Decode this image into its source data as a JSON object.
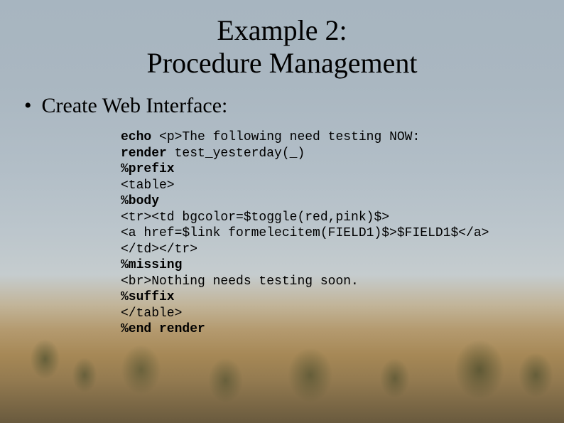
{
  "title_line1": "Example 2:",
  "title_line2": "Procedure Management",
  "bullet": "•",
  "bullet_text": "Create Web Interface:",
  "code": {
    "l1a": "echo",
    "l1b": " <p>The following need testing NOW:",
    "l2a": "render",
    "l2b": " test_yesterday(_)",
    "l3": "%prefix",
    "l4": "<table>",
    "l5": "%body",
    "l6": "<tr><td bgcolor=$toggle(red,pink)$>",
    "l7": "<a href=$link formelecitem(FIELD1)$>$FIELD1$</a>",
    "l8": "</td></tr>",
    "l9": "%missing",
    "l10": "<br>Nothing needs testing soon.",
    "l11": "%suffix",
    "l12": "</table>",
    "l13": "%end render"
  }
}
